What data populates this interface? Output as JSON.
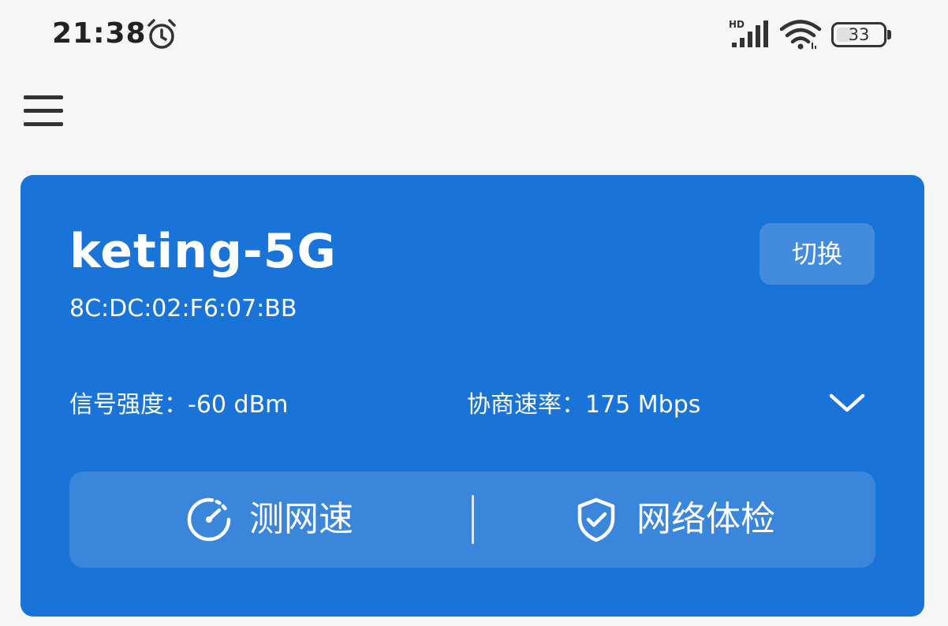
{
  "status_bar": {
    "time": "21:38",
    "signal_label": "HD",
    "battery_level": "33",
    "icons": [
      "alarm-icon",
      "cellular-signal-icon",
      "wifi-icon",
      "battery-icon"
    ]
  },
  "menu": {
    "icon": "hamburger-menu-icon"
  },
  "wifi_card": {
    "ssid": "keting-5G",
    "mac": "8C:DC:02:F6:07:BB",
    "switch_label": "切换",
    "signal_strength": "信号强度：-60 dBm",
    "link_rate": "协商速率：175 Mbps",
    "expand_icon": "chevron-down-icon",
    "actions": [
      {
        "label": "测网速",
        "icon": "speedometer-icon"
      },
      {
        "label": "网络体检",
        "icon": "shield-check-icon"
      }
    ],
    "colors": {
      "card": "#1a73d6",
      "text": "#ffffff"
    }
  }
}
